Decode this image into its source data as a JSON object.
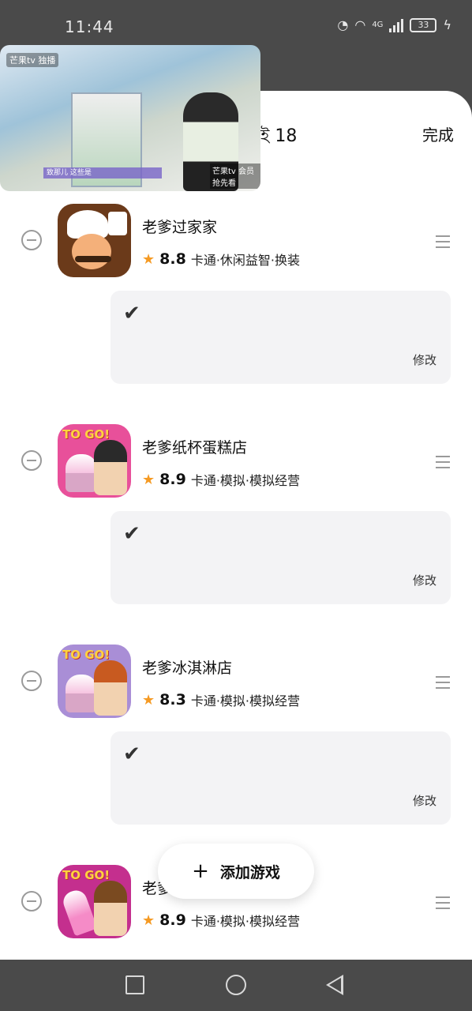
{
  "status_bar": {
    "time": "11:44",
    "network": "4G",
    "battery": "33"
  },
  "header": {
    "title_fragment": "ই 18",
    "done_label": "完成"
  },
  "video_overlay": {
    "channel_logo_tl": "芒果tv 独播",
    "caption": "致那儿  这些是",
    "channel_logo_br": "芒果tv 会员抢先看"
  },
  "games": [
    {
      "name": "老爹过家家",
      "score": "8.8",
      "tags": "卡通·休闲益智·换装",
      "icon": "papas-chef-icon",
      "note_mark": "✔",
      "edit_label": "修改"
    },
    {
      "name": "老爹纸杯蛋糕店",
      "score": "8.9",
      "tags": "卡通·模拟·模拟经营",
      "icon": "papas-cupcakeria-icon",
      "badge": "TO GO!",
      "note_mark": "✔",
      "edit_label": "修改"
    },
    {
      "name": "老爹冰淇淋店",
      "score": "8.3",
      "tags": "卡通·模拟·模拟经营",
      "icon": "papas-scooperia-icon",
      "badge": "TO GO!",
      "note_mark": "✔",
      "edit_label": "修改"
    },
    {
      "name": "老爹",
      "score": "8.9",
      "tags": "卡通·模拟·模拟经营",
      "icon": "papas-paleteria-icon",
      "badge": "TO GO!"
    }
  ],
  "add_button": {
    "plus": "+",
    "label": "添加游戏"
  },
  "colors": {
    "star": "#f59a23",
    "note_bg": "#f3f3f5",
    "system_bar": "#4a4a4a"
  }
}
